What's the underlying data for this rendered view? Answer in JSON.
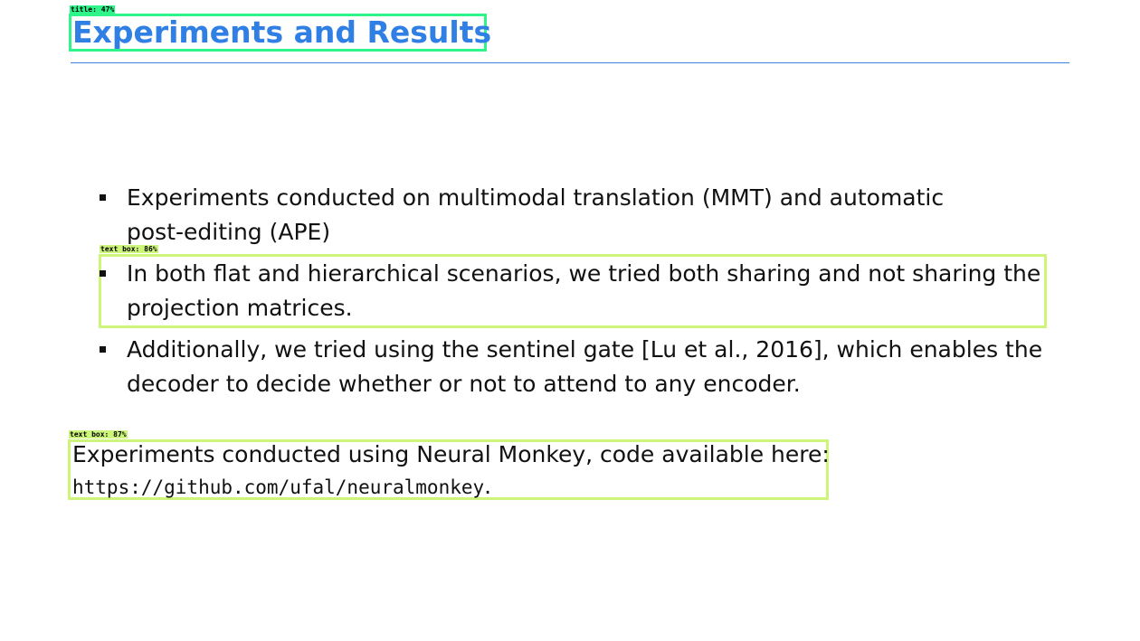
{
  "detections": {
    "title_tag": "title: 47%",
    "bullet_tag": "text box: 86%",
    "note_tag": "text box: 87%"
  },
  "slide": {
    "title": "Experiments and Results",
    "bullets": [
      {
        "line1": "Experiments conducted on multimodal translation (MMT) and automatic",
        "line2": "post-editing (APE)"
      },
      {
        "line1": "In both flat and hierarchical scenarios, we tried both sharing and not sharing the",
        "line2": "projection matrices."
      },
      {
        "line1": "Additionally, we tried using the sentinel gate [Lu et al., 2016], which enables the",
        "line2": "decoder to decide whether or not to attend to any encoder."
      }
    ],
    "note": {
      "text": "Experiments conducted using Neural Monkey, code available here:",
      "url": "https://github.com/ufal/neuralmonkey",
      "url_suffix": "."
    }
  },
  "colors": {
    "title": "#2f7fe5",
    "rule": "#3b82e0",
    "title_box": "#2ef58a",
    "text_box": "#cdf57a"
  }
}
